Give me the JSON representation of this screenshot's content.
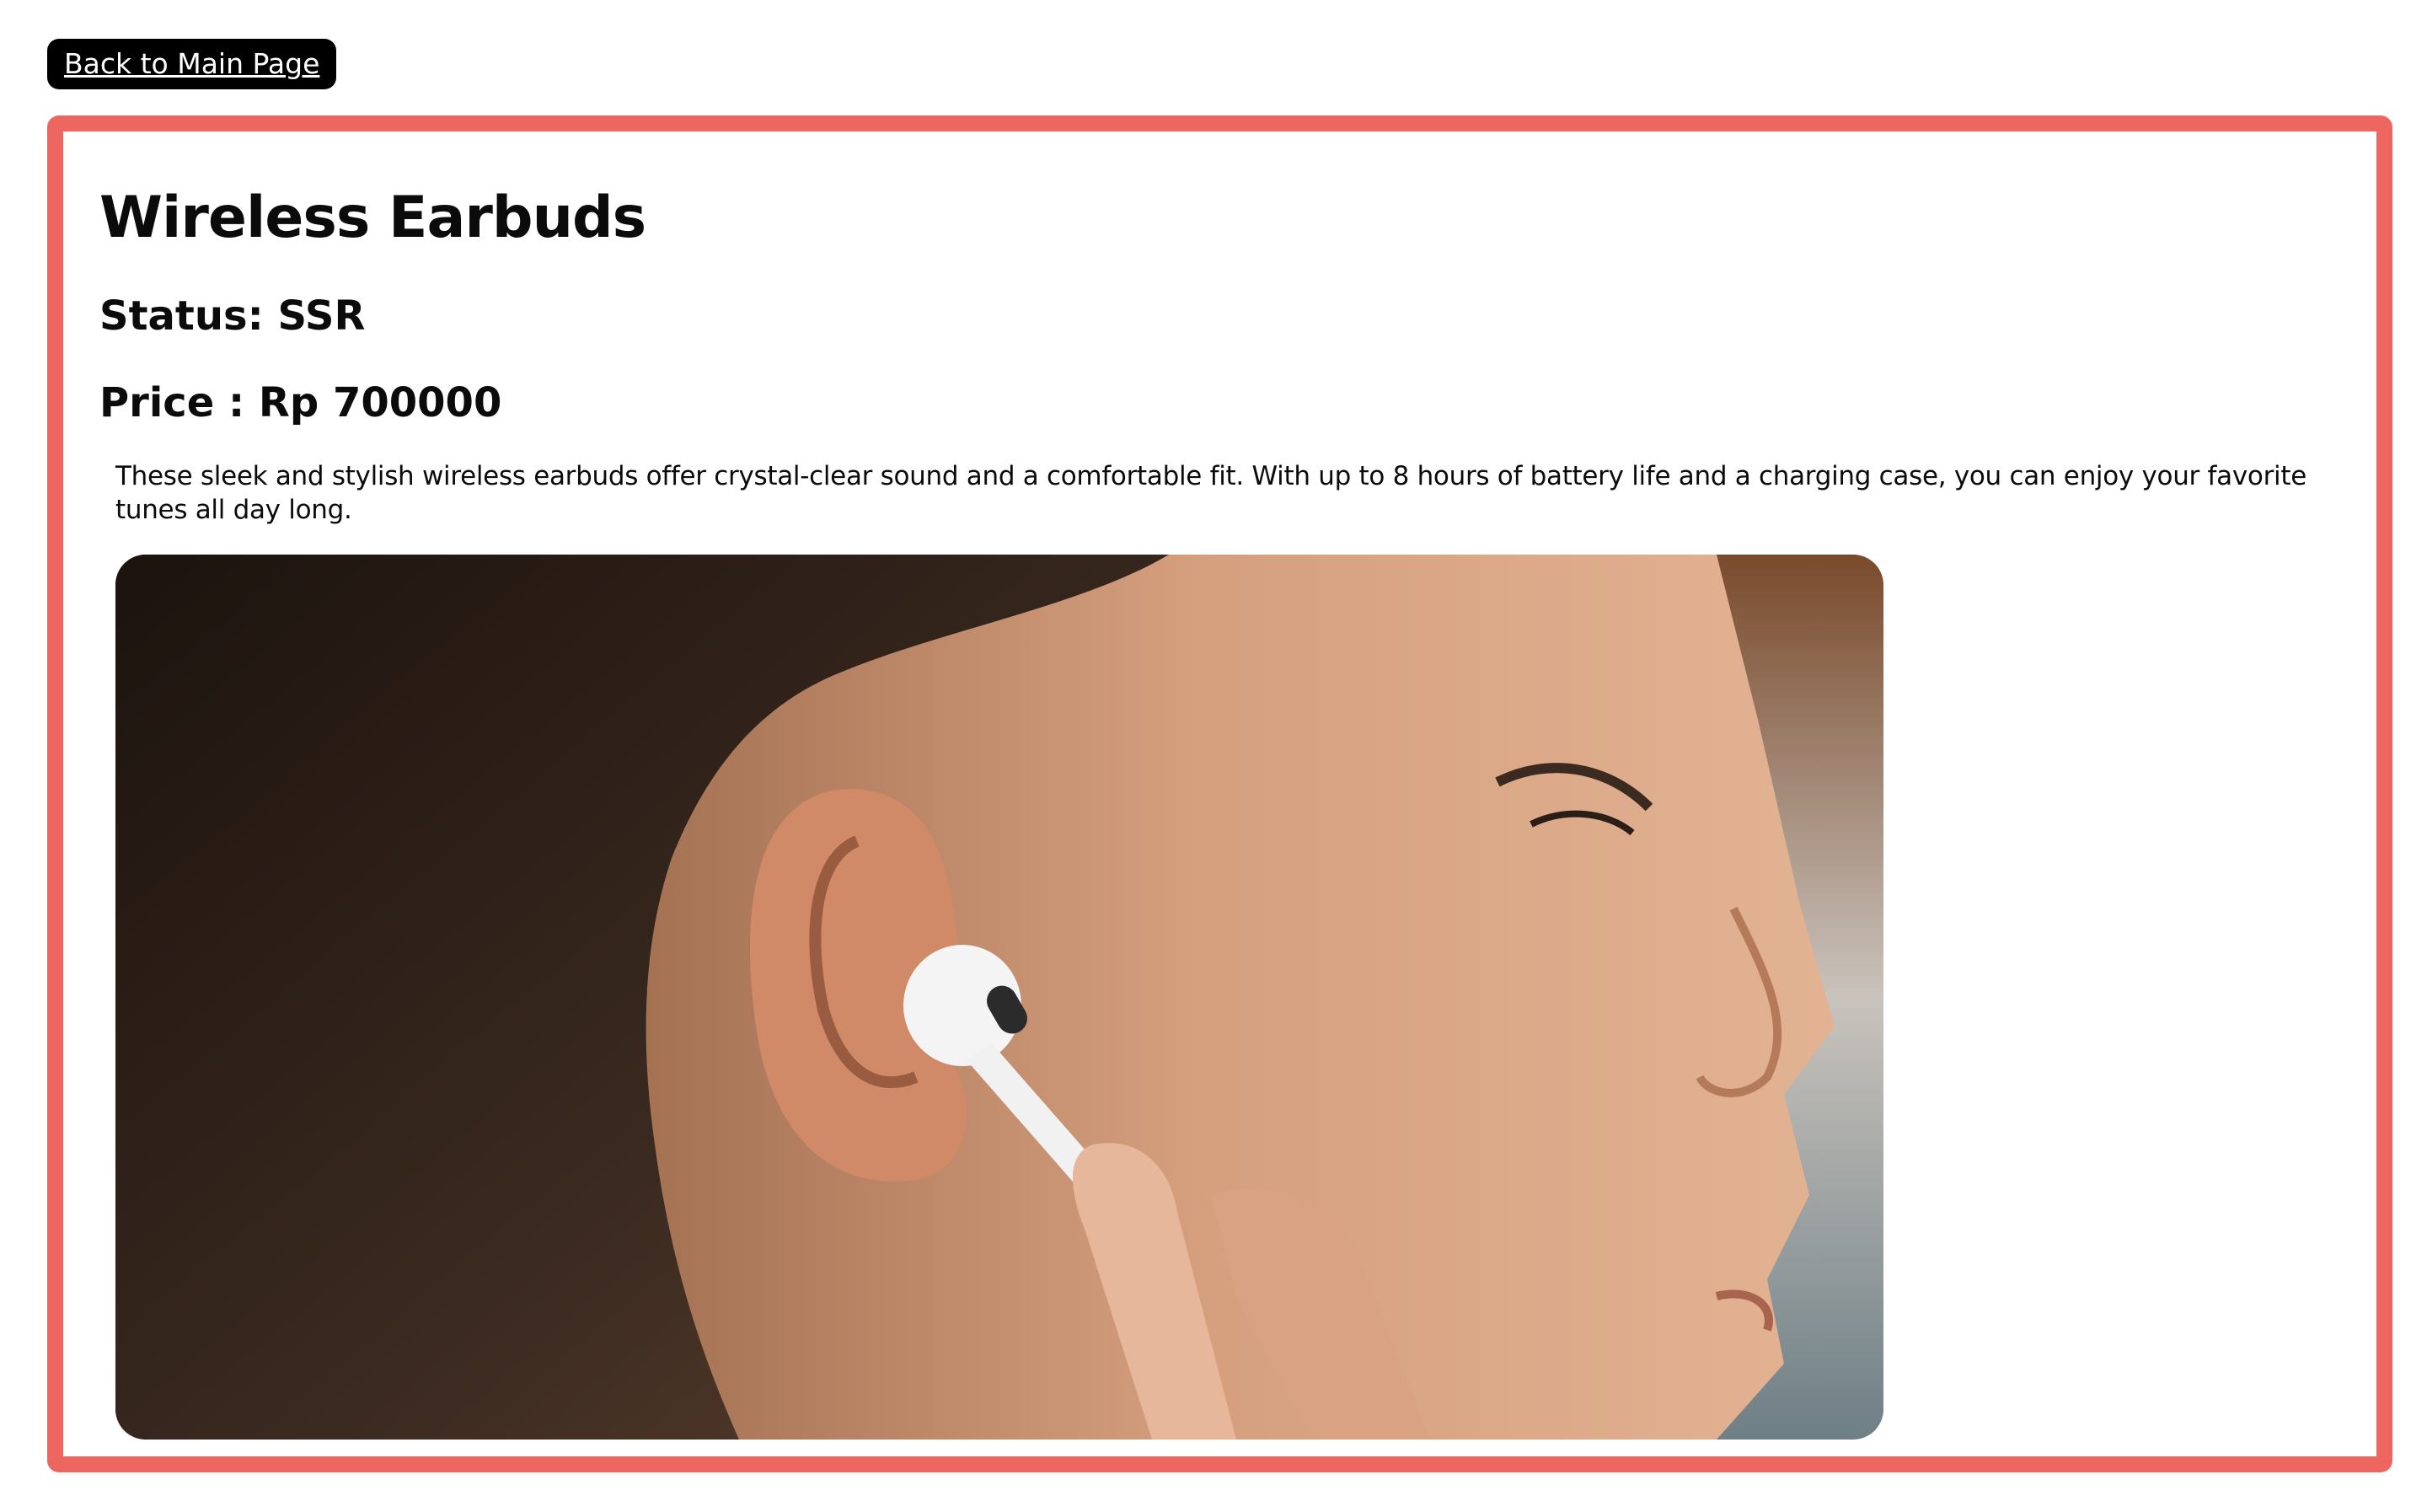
{
  "navigation": {
    "back_label": "Back to Main Page"
  },
  "product": {
    "title": "Wireless Earbuds",
    "status": "Status: SSR",
    "price": "Price : Rp 700000",
    "description": "These sleek and stylish wireless earbuds offer crystal-clear sound and a comfortable fit. With up to 8 hours of battery life and a charging case, you can enjoy your favorite tunes all day long."
  },
  "colors": {
    "card_border": "#ee6660",
    "button_background": "#000000",
    "button_text": "#ffffff",
    "text": "#0b0b0b",
    "background": "#ffffff"
  }
}
